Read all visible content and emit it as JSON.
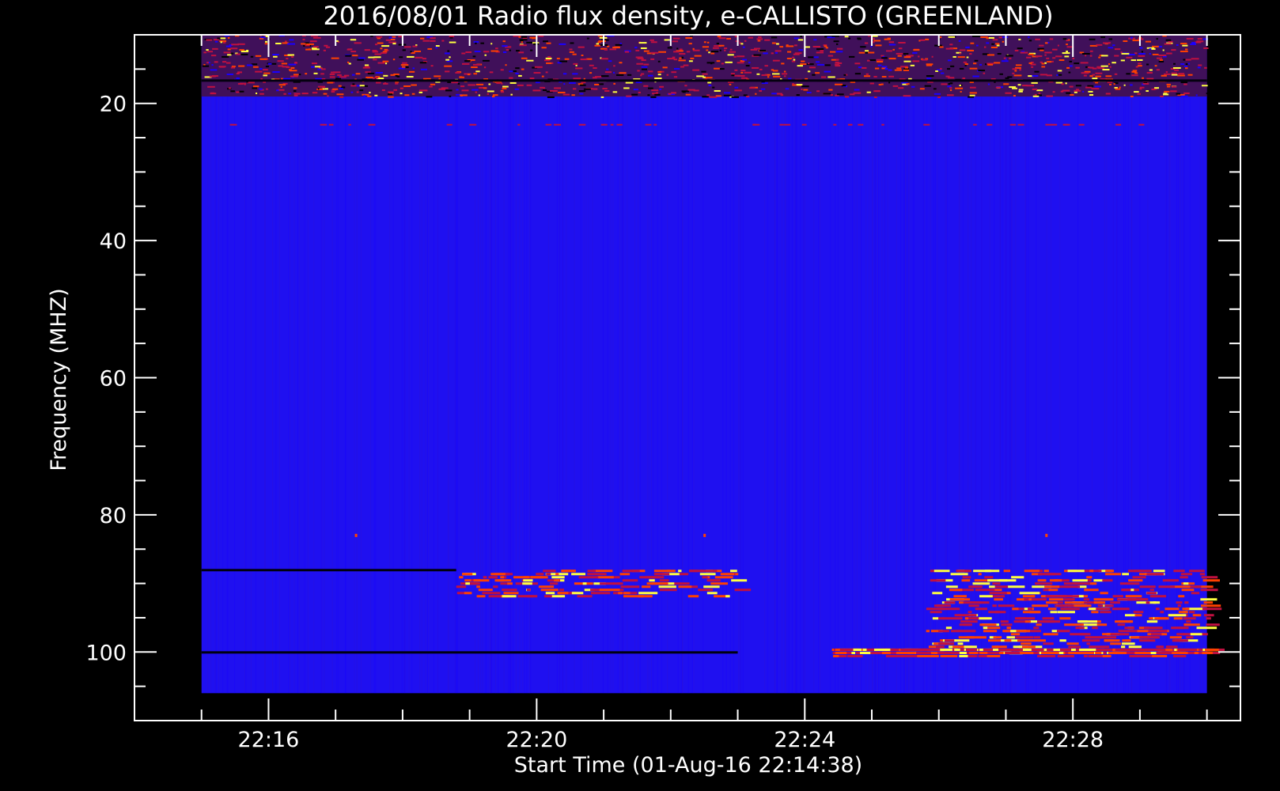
{
  "chart_data": {
    "type": "heatmap",
    "title": "2016/08/01  Radio flux density, e-CALLISTO (GREENLAND)",
    "xlabel": "Start Time (01-Aug-16 22:14:38)",
    "ylabel": "Frequency (MHZ)",
    "x_ticks": [
      {
        "label": "22:16",
        "minute": 16
      },
      {
        "label": "22:20",
        "minute": 20
      },
      {
        "label": "22:24",
        "minute": 24
      },
      {
        "label": "22:28",
        "minute": 28
      }
    ],
    "y_ticks": [
      20,
      40,
      60,
      80,
      100
    ],
    "xlim_minutes": [
      14.0,
      30.5
    ],
    "ylim_mhz": [
      10,
      110
    ],
    "data_extent": {
      "time_start_minute": 15.0,
      "time_end_minute": 30.0,
      "freq_min_mhz": 10,
      "freq_max_mhz": 106
    },
    "y_axis_inverted": true,
    "colormap": [
      "#000000",
      "#1a00ff",
      "#2000ff",
      "#c01040",
      "#ff4000",
      "#ffff40"
    ],
    "background_color": "#1f10f0",
    "features": [
      {
        "type": "rfi_band",
        "freq_mhz": [
          10,
          19
        ],
        "time_minutes": [
          15.0,
          30.0
        ],
        "intensity": "high"
      },
      {
        "type": "dark_line",
        "freq_mhz": 88,
        "time_minutes": [
          15.0,
          18.8
        ]
      },
      {
        "type": "dark_line",
        "freq_mhz": 100,
        "time_minutes": [
          15.0,
          23.0
        ]
      },
      {
        "type": "emission",
        "freq_mhz": [
          88,
          92
        ],
        "time_minutes": [
          18.8,
          23.0
        ],
        "intensity": "medium"
      },
      {
        "type": "emission",
        "freq_mhz": [
          88,
          100
        ],
        "time_minutes": [
          25.8,
          30.0
        ],
        "intensity": "high"
      },
      {
        "type": "emission",
        "freq_mhz": [
          99.5,
          100.5
        ],
        "time_minutes": [
          24.4,
          30.0
        ],
        "intensity": "high"
      },
      {
        "type": "point",
        "freq_mhz": 83,
        "time_minutes": 17.3
      },
      {
        "type": "point",
        "freq_mhz": 83,
        "time_minutes": 22.5
      },
      {
        "type": "point",
        "freq_mhz": 83,
        "time_minutes": 27.6
      }
    ]
  }
}
